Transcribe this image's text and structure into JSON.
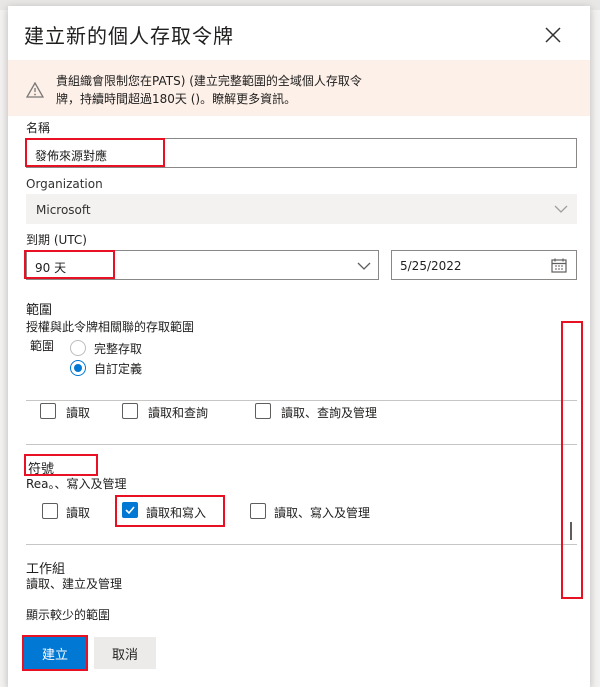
{
  "dialog": {
    "title": "建立新的個人存取令牌",
    "warning": {
      "line1": "貴組織會限制您在PATS) (建立完整範圍的全域個人存取令",
      "line2": "牌，持續時間超過180天 ()。瞭解更多資訊。"
    },
    "name": {
      "label": "名稱",
      "value": "發佈來源對應"
    },
    "organization": {
      "label": "Organization",
      "value": "Microsoft"
    },
    "expiration": {
      "label": "到期 (UTC)",
      "value": "90 天",
      "date": "5/25/2022"
    },
    "scopes": {
      "heading": "範圍",
      "description": "授權與此令牌相關聯的存取範圍",
      "sub_label": "範圍",
      "options": [
        "完整存取",
        "自訂定義"
      ],
      "selected": "自訂定義"
    },
    "prev_group": {
      "options": [
        "讀取",
        "讀取和查詢",
        "讀取、查詢及管理"
      ]
    },
    "symbols": {
      "title": "符號",
      "description": "Rea。、寫入及管理",
      "options": [
        "讀取",
        "讀取和寫入",
        "讀取、寫入及管理"
      ],
      "checked": "讀取和寫入"
    },
    "workitems": {
      "title": "工作組",
      "description": "讀取、建立及管理"
    },
    "show_less": "顯示較少的範圍",
    "create_label": "建立",
    "cancel_label": "取消"
  },
  "colors": {
    "accent": "#0078d4",
    "highlight": "#e81123",
    "warning_bg": "#fdf0e9"
  }
}
